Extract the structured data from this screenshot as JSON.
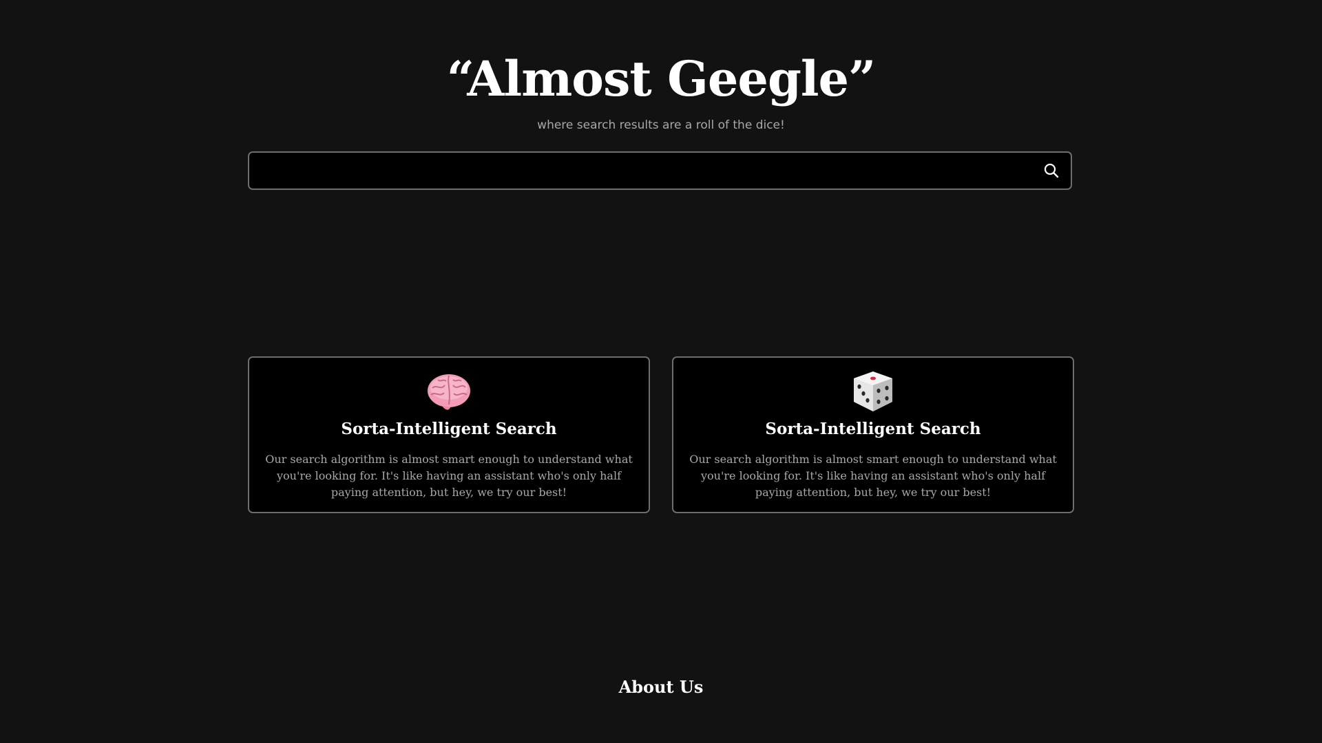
{
  "header": {
    "title": "“Almost Geegle”",
    "tagline": "where search results are a roll of the dice!"
  },
  "search": {
    "value": "",
    "placeholder": "",
    "button_icon": "search-icon"
  },
  "features": [
    {
      "icon": "brain-icon",
      "title": "Sorta-Intelligent Search",
      "description": "Our search algorithm is almost smart enough to understand what you're looking for. It's like having an assistant who's only half paying attention, but hey, we try our best!"
    },
    {
      "icon": "dice-icon",
      "title": "Sorta-Intelligent Search",
      "description": "Our search algorithm is almost smart enough to understand what you're looking for. It's like having an assistant who's only half paying attention, but hey, we try our best!"
    }
  ],
  "about": {
    "heading": "About Us"
  },
  "colors": {
    "background": "#121212",
    "surface": "#000000",
    "border": "#6e6e6e",
    "muted_text": "#a8a8a8",
    "brain_pink": "#f29cb5",
    "dice_white": "#eeeeee",
    "dice_red_pip": "#d6283c"
  }
}
